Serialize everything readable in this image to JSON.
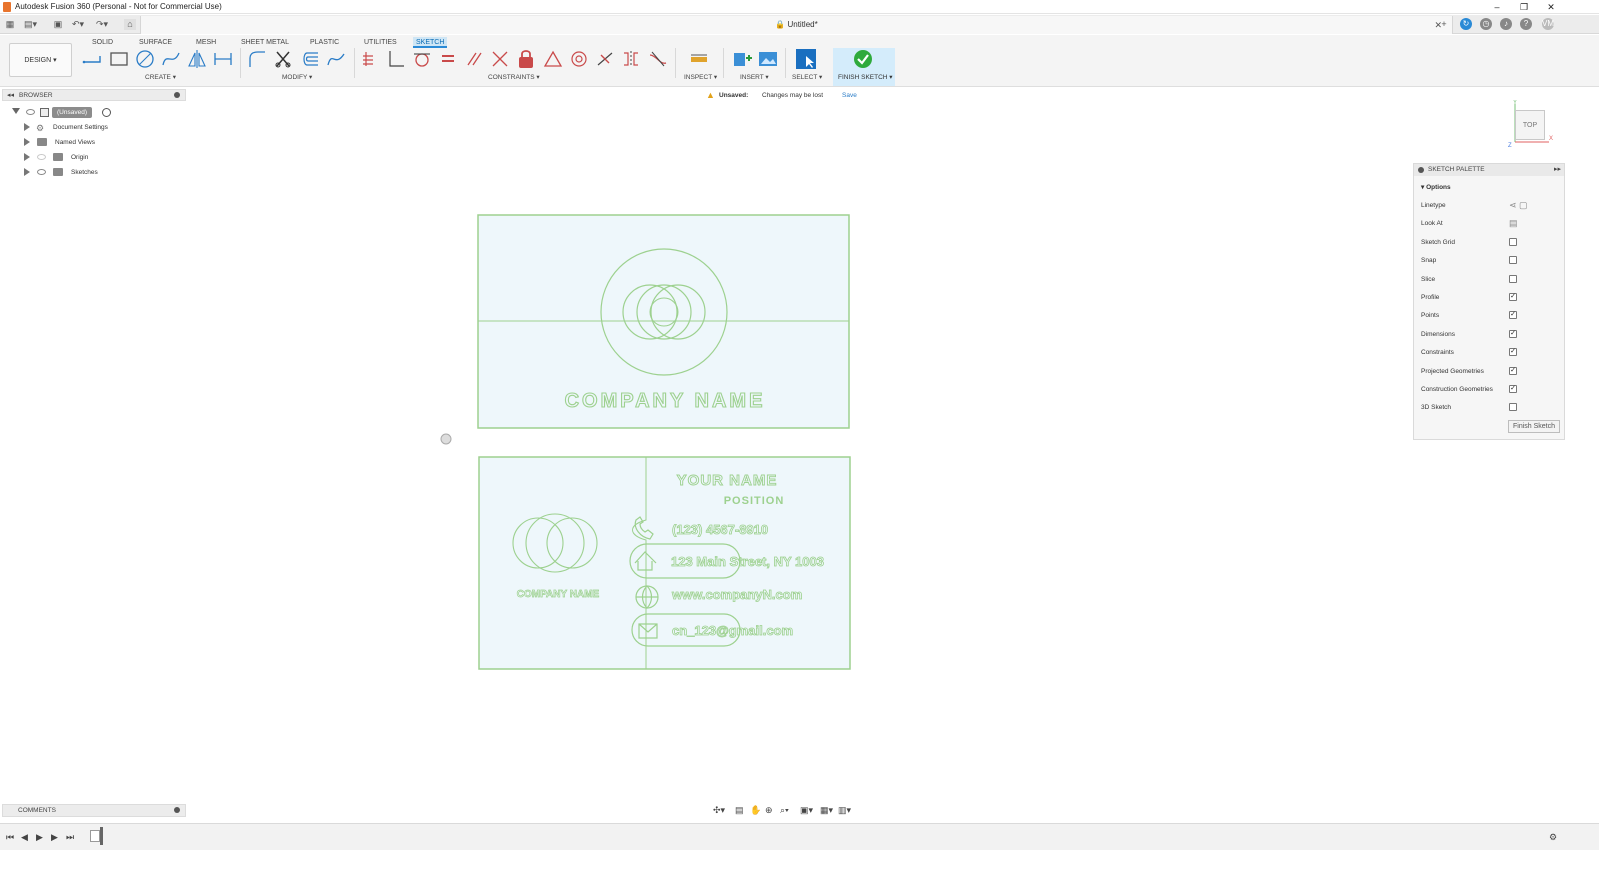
{
  "app": {
    "window_title": "Autodesk Fusion 360 (Personal - Not for Commercial Use)",
    "document_tab": "Untitled*",
    "user_initials": "VM"
  },
  "ribbon": {
    "workspace": "DESIGN ▾",
    "tabs": [
      "SOLID",
      "SURFACE",
      "MESH",
      "SHEET METAL",
      "PLASTIC",
      "UTILITIES",
      "SKETCH"
    ],
    "active_tab": "SKETCH",
    "groups": [
      "CREATE ▾",
      "MODIFY ▾",
      "CONSTRAINTS ▾",
      "INSPECT ▾",
      "INSERT ▾",
      "SELECT ▾",
      "FINISH SKETCH ▾"
    ]
  },
  "browser": {
    "title": "BROWSER",
    "root": "(Unsaved)",
    "items": [
      "Document Settings",
      "Named Views",
      "Origin",
      "Sketches"
    ]
  },
  "banner": {
    "label": "Unsaved:",
    "message": "Changes may be lost",
    "save": "Save"
  },
  "viewcube": {
    "face": "TOP"
  },
  "palette": {
    "title": "SKETCH PALETTE",
    "section": "Options",
    "rows": [
      {
        "label": "Linetype",
        "checked": null
      },
      {
        "label": "Look At",
        "checked": null
      },
      {
        "label": "Sketch Grid",
        "checked": false
      },
      {
        "label": "Snap",
        "checked": false
      },
      {
        "label": "Slice",
        "checked": false
      },
      {
        "label": "Profile",
        "checked": true
      },
      {
        "label": "Points",
        "checked": true
      },
      {
        "label": "Dimensions",
        "checked": true
      },
      {
        "label": "Constraints",
        "checked": true
      },
      {
        "label": "Projected Geometries",
        "checked": true
      },
      {
        "label": "Construction Geometries",
        "checked": true
      },
      {
        "label": "3D Sketch",
        "checked": false
      }
    ],
    "finish_button": "Finish Sketch"
  },
  "sketch": {
    "front_company": "COMPANY NAME",
    "back_company": "COMPANY NAME",
    "name": "YOUR NAME",
    "position": "POSITION",
    "phone": "(123) 4567-8910",
    "address": "123 Main Street, NY 1003",
    "website": "www.companyN.com",
    "email": "cn_123@gmail.com",
    "stroke_color": "#9dd18f",
    "fill_color": "#eef7fb"
  },
  "comments": {
    "title": "COMMENTS"
  }
}
